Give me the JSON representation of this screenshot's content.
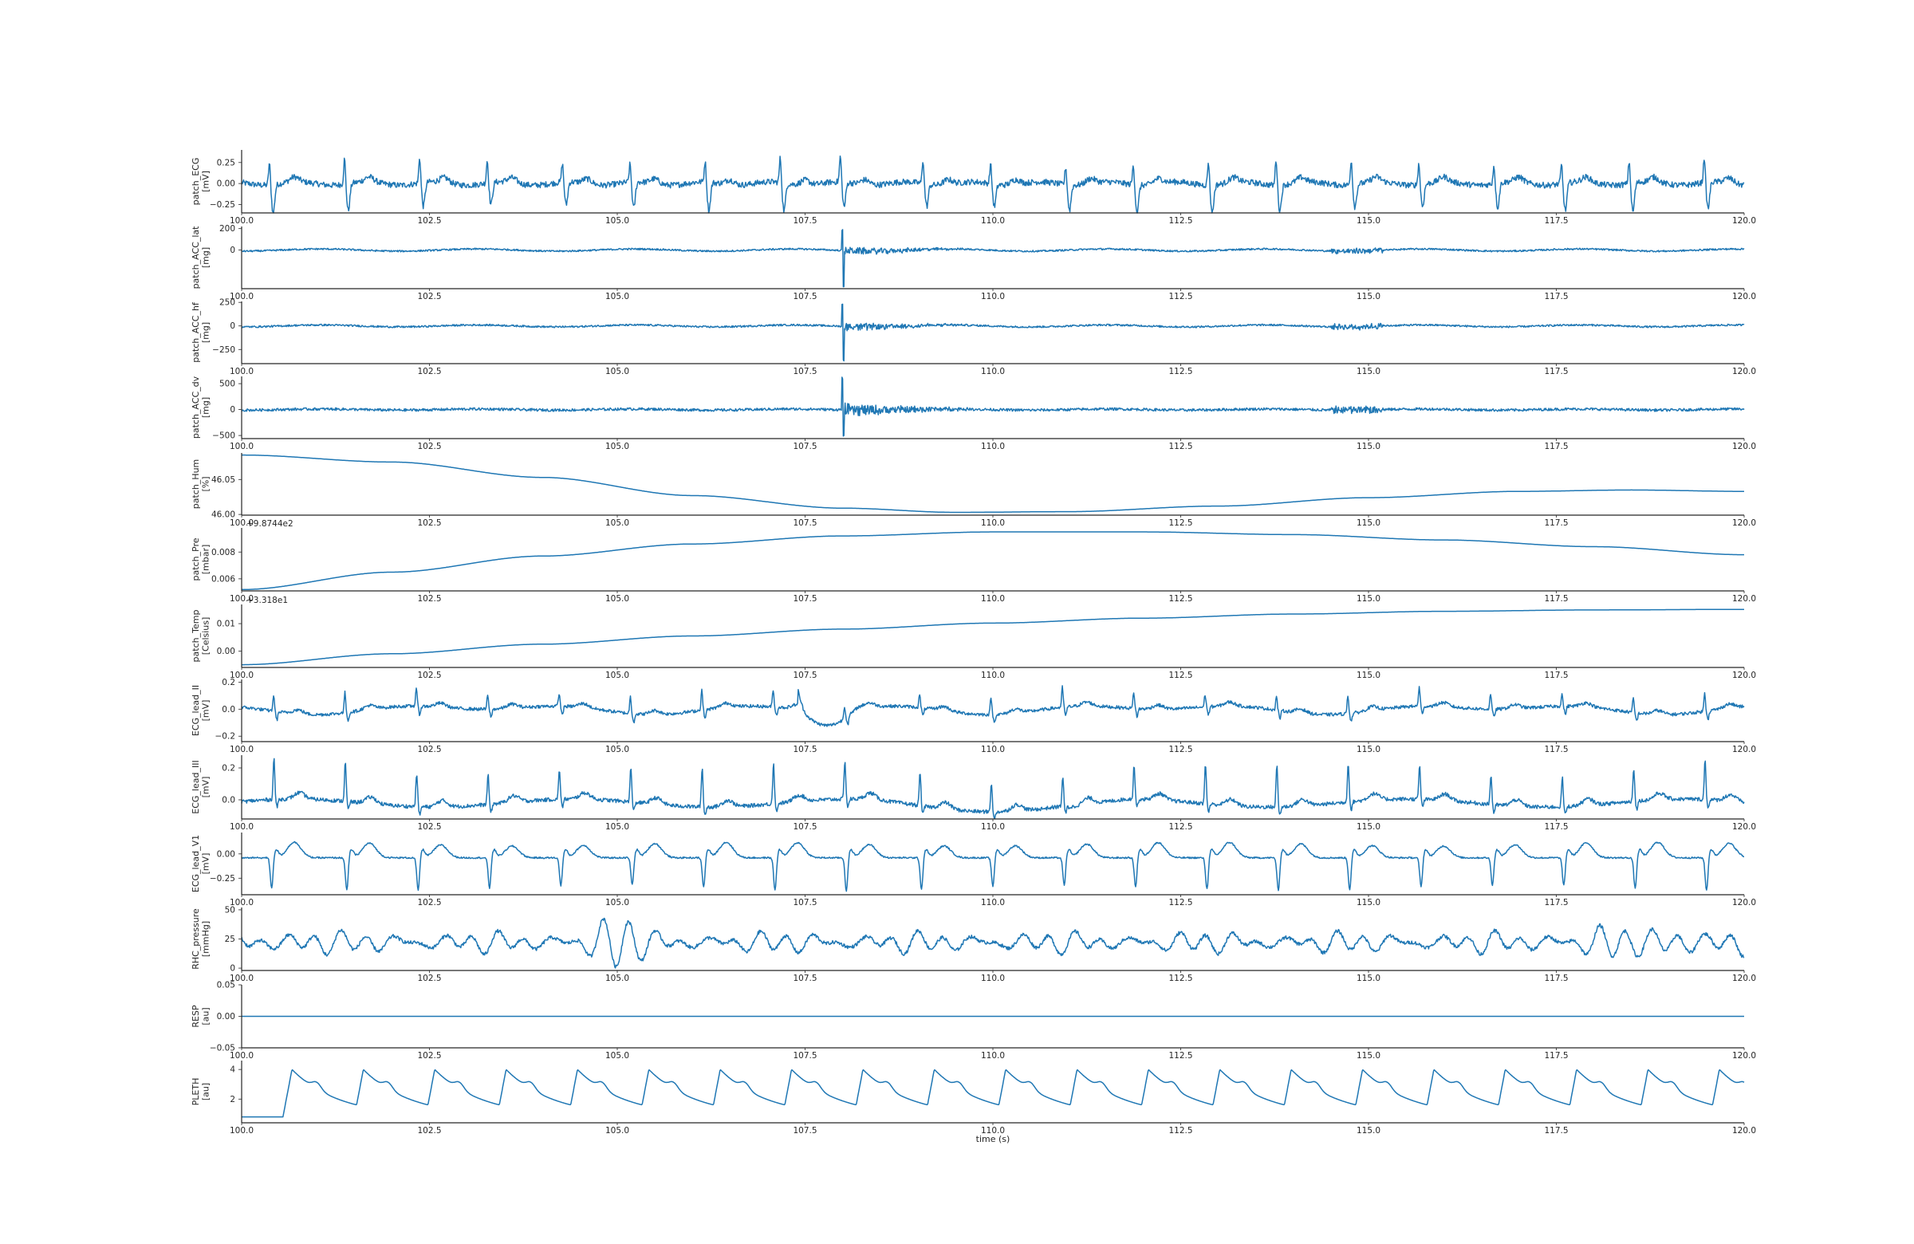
{
  "chart_data": {
    "type": "line",
    "x_range": [
      100.0,
      120.0
    ],
    "x_ticks": [
      "100.0",
      "102.5",
      "105.0",
      "107.5",
      "110.0",
      "112.5",
      "115.0",
      "117.5",
      "120.0"
    ],
    "x_tick_values": [
      100.0,
      102.5,
      105.0,
      107.5,
      110.0,
      112.5,
      115.0,
      117.5,
      120.0
    ],
    "xlabel": "time (s)",
    "grid": false,
    "panels": [
      {
        "key": "patch_ecg",
        "ylabel": [
          "patch_ECG",
          "[mV]"
        ],
        "ylim": [
          -0.35,
          0.4
        ],
        "yticks": [
          0.25,
          0.0,
          -0.25
        ],
        "ytick_labels": [
          "0.25",
          "0.00",
          "−0.25"
        ],
        "offset_label": "",
        "waveform": "ecg_patch",
        "beats": [
          100.4,
          101.4,
          102.4,
          103.3,
          104.3,
          105.2,
          106.2,
          107.2,
          108.0,
          109.1,
          110.0,
          111.0,
          111.9,
          112.9,
          113.8,
          114.8,
          115.7,
          116.7,
          117.6,
          118.5,
          119.5
        ]
      },
      {
        "key": "patch_acc_lat",
        "ylabel": [
          "patch_ACC_lat",
          "[mg]"
        ],
        "ylim": [
          -360,
          220
        ],
        "yticks": [
          200,
          0
        ],
        "ytick_labels": [
          "200",
          "0"
        ],
        "offset_label": "",
        "waveform": "acc",
        "spike_t": 108.0,
        "spike_up": 190,
        "spike_down": -340
      },
      {
        "key": "patch_acc_hf",
        "ylabel": [
          "patch_ACC_hf",
          "[mg]"
        ],
        "ylim": [
          -400,
          260
        ],
        "yticks": [
          250,
          0,
          -250
        ],
        "ytick_labels": [
          "250",
          "0",
          "−250"
        ],
        "offset_label": "",
        "waveform": "acc",
        "spike_t": 108.0,
        "spike_up": 230,
        "spike_down": -360
      },
      {
        "key": "patch_acc_dv",
        "ylabel": [
          "patch_ACC_dv",
          "[mg]"
        ],
        "ylim": [
          -560,
          640
        ],
        "yticks": [
          500,
          0,
          -500
        ],
        "ytick_labels": [
          "500",
          "0",
          "−500"
        ],
        "offset_label": "",
        "waveform": "acc",
        "spike_t": 108.0,
        "spike_up": 620,
        "spike_down": -520
      },
      {
        "key": "patch_hum",
        "ylabel": [
          "patch_Hum",
          "[%]"
        ],
        "ylim": [
          45.999,
          46.088
        ],
        "yticks": [
          46.05,
          46.0
        ],
        "ytick_labels": [
          "46.05",
          "46.00"
        ],
        "offset_label": "",
        "waveform": "smooth",
        "points": [
          [
            100,
            46.085
          ],
          [
            102,
            46.075
          ],
          [
            104,
            46.053
          ],
          [
            106,
            46.027
          ],
          [
            108,
            46.009
          ],
          [
            109.5,
            46.003
          ],
          [
            111,
            46.004
          ],
          [
            113,
            46.012
          ],
          [
            115,
            46.024
          ],
          [
            117,
            46.033
          ],
          [
            118.5,
            46.035
          ],
          [
            120,
            46.033
          ]
        ]
      },
      {
        "key": "patch_pre",
        "ylabel": [
          "patch_Pre",
          "[mbar]"
        ],
        "ylim": [
          0.0051,
          0.0098
        ],
        "yticks": [
          0.008,
          0.006
        ],
        "ytick_labels": [
          "0.008",
          "0.006"
        ],
        "offset_label": "1e−8744e2",
        "offset_text": "+9.8744e2",
        "waveform": "smooth",
        "points": [
          [
            100,
            0.0052
          ],
          [
            102,
            0.0065
          ],
          [
            104,
            0.0077
          ],
          [
            106,
            0.0086
          ],
          [
            108,
            0.0092
          ],
          [
            110,
            0.0095
          ],
          [
            112,
            0.0095
          ],
          [
            114,
            0.0093
          ],
          [
            116,
            0.0089
          ],
          [
            118,
            0.0084
          ],
          [
            120,
            0.0078
          ]
        ]
      },
      {
        "key": "patch_temp",
        "ylabel": [
          "patch_Temp",
          "[Celsius]"
        ],
        "ylim": [
          -0.006,
          0.017
        ],
        "yticks": [
          0.01,
          0.0
        ],
        "ytick_labels": [
          "0.01",
          "0.00"
        ],
        "offset_label": "+3.318e1",
        "waveform": "smooth",
        "points": [
          [
            100,
            -0.005
          ],
          [
            102,
            -0.001
          ],
          [
            104,
            0.0025
          ],
          [
            106,
            0.0055
          ],
          [
            108,
            0.008
          ],
          [
            110,
            0.0102
          ],
          [
            112,
            0.012
          ],
          [
            114,
            0.0135
          ],
          [
            116,
            0.0145
          ],
          [
            118,
            0.015
          ],
          [
            120,
            0.0152
          ]
        ]
      },
      {
        "key": "ecg_lead_ii",
        "ylabel": [
          "ECG_lead_II",
          "[mV]"
        ],
        "ylim": [
          -0.24,
          0.22
        ],
        "yticks": [
          0.2,
          0.0,
          -0.2
        ],
        "ytick_labels": [
          "0.2",
          "0.0",
          "−0.2"
        ],
        "offset_label": "",
        "waveform": "ecg_limb",
        "beats": [
          100.45,
          101.4,
          102.35,
          103.3,
          104.25,
          105.2,
          106.15,
          107.1,
          108.05,
          109.05,
          110.0,
          110.95,
          111.9,
          112.85,
          113.8,
          114.75,
          115.7,
          116.65,
          117.6,
          118.55,
          119.5
        ]
      },
      {
        "key": "ecg_lead_iii",
        "ylabel": [
          "ECG_lead_III",
          "[mV]"
        ],
        "ylim": [
          -0.12,
          0.28
        ],
        "yticks": [
          0.2,
          0.0
        ],
        "ytick_labels": [
          "0.2",
          "0.0"
        ],
        "offset_label": "",
        "waveform": "ecg_limb3",
        "beats": [
          100.45,
          101.4,
          102.35,
          103.3,
          104.25,
          105.2,
          106.15,
          107.1,
          108.05,
          109.05,
          110.0,
          110.95,
          111.9,
          112.85,
          113.8,
          114.75,
          115.7,
          116.65,
          117.6,
          118.55,
          119.5
        ]
      },
      {
        "key": "ecg_lead_v1",
        "ylabel": [
          "ECG_lead_V1",
          "[mV]"
        ],
        "ylim": [
          -0.42,
          0.22
        ],
        "yticks": [
          0.0,
          -0.25
        ],
        "ytick_labels": [
          "0.00",
          "−0.25"
        ],
        "offset_label": "",
        "waveform": "ecg_v1",
        "beats": [
          100.4,
          101.4,
          102.35,
          103.3,
          104.25,
          105.2,
          106.15,
          107.1,
          108.05,
          109.05,
          110.0,
          110.95,
          111.9,
          112.85,
          113.8,
          114.75,
          115.7,
          116.65,
          117.6,
          118.55,
          119.5
        ]
      },
      {
        "key": "rhc_pressure",
        "ylabel": [
          "RHC_pressure",
          "[mmHg]"
        ],
        "ylim": [
          -2,
          52
        ],
        "yticks": [
          50,
          25,
          0
        ],
        "ytick_labels": [
          "50",
          "25",
          "0"
        ],
        "offset_label": "",
        "waveform": "pressure"
      },
      {
        "key": "resp",
        "ylabel": [
          "RESP",
          "[au]"
        ],
        "ylim": [
          -0.05,
          0.05
        ],
        "yticks": [
          0.05,
          0.0,
          -0.05
        ],
        "ytick_labels": [
          "0.05",
          "0.00",
          "−0.05"
        ],
        "offset_label": "",
        "waveform": "flat",
        "value": 0.0
      },
      {
        "key": "pleth",
        "ylabel": [
          "PLETH",
          "[au]"
        ],
        "ylim": [
          0.4,
          4.6
        ],
        "yticks": [
          4,
          2
        ],
        "ytick_labels": [
          "4",
          "2"
        ],
        "offset_label": "",
        "waveform": "pleth",
        "beats": [
          100.55,
          101.5,
          102.45,
          103.4,
          104.35,
          105.3,
          106.25,
          107.2,
          108.15,
          109.1,
          110.05,
          111.0,
          111.95,
          112.9,
          113.85,
          114.8,
          115.75,
          116.7,
          117.65,
          118.6,
          119.55
        ]
      }
    ]
  }
}
